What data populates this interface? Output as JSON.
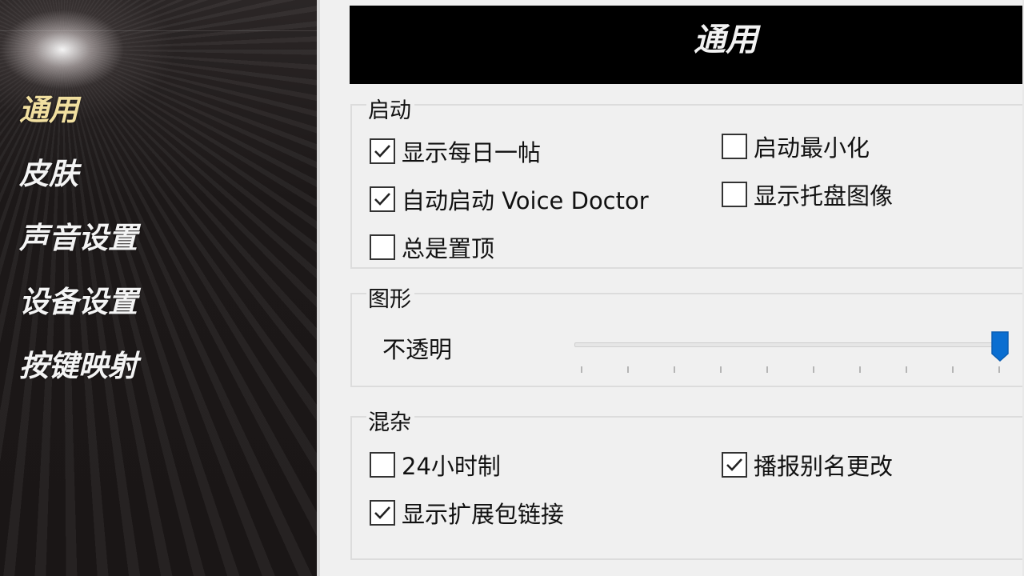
{
  "sidebar": {
    "items": [
      {
        "label": "通用",
        "active": true
      },
      {
        "label": "皮肤",
        "active": false
      },
      {
        "label": "声音设置",
        "active": false
      },
      {
        "label": "设备设置",
        "active": false
      },
      {
        "label": "按键映射",
        "active": false
      }
    ]
  },
  "header": {
    "title": "通用"
  },
  "startup": {
    "legend": "启动",
    "show_daily_tip": {
      "label": "显示每日一帖",
      "checked": true
    },
    "autostart_voice_doctor": {
      "label": "自动启动 Voice Doctor",
      "checked": true
    },
    "always_on_top": {
      "label": "总是置顶",
      "checked": false
    },
    "start_minimized": {
      "label": "启动最小化",
      "checked": false
    },
    "show_tray_icon": {
      "label": "显示托盘图像",
      "checked": false
    }
  },
  "graphics": {
    "legend": "图形",
    "opacity_label": "不透明",
    "opacity_value": 1.0,
    "tick_count": 10
  },
  "misc": {
    "legend": "混杂",
    "clock_24h": {
      "label": "24小时制",
      "checked": false
    },
    "show_expansion_links": {
      "label": "显示扩展包链接",
      "checked": true
    },
    "announce_alias_change": {
      "label": "播报别名更改",
      "checked": true
    }
  },
  "colors": {
    "active_nav": "#f1dfa0",
    "slider_thumb": "#0a6ed1"
  },
  "icons": {
    "checkmark": "checkmark-icon",
    "slider_thumb": "slider-thumb-icon"
  }
}
